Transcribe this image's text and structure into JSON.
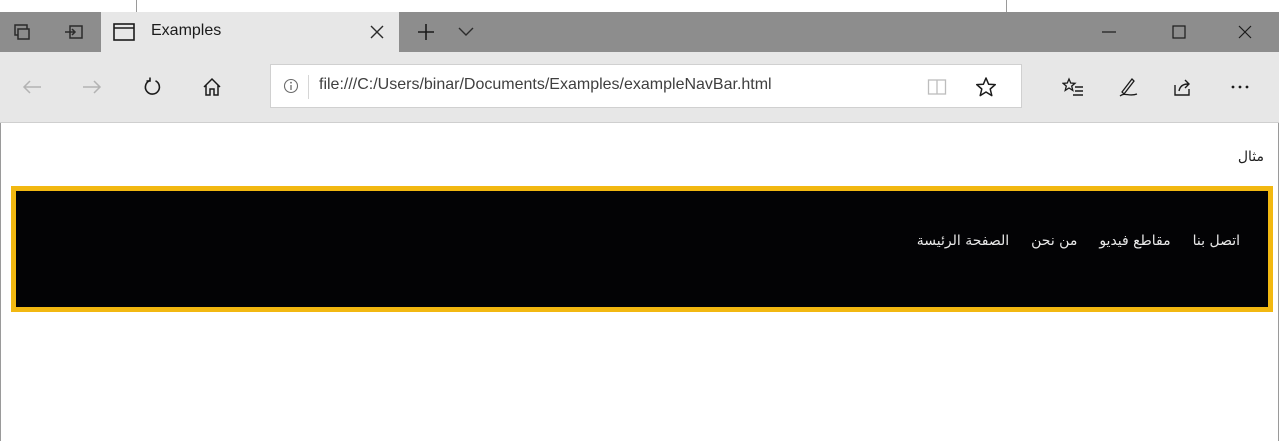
{
  "browser": {
    "tab_title": "Examples",
    "address_url": "file:///C:/Users/binar/Documents/Examples/exampleNavBar.html",
    "icons": {
      "set_aside": "tabs-aside-icon",
      "show_aside": "tabs-restore-icon",
      "tab_page": "page-icon",
      "tab_close": "close-icon",
      "new_tab": "plus-icon",
      "tab_preview": "chevron-down-icon",
      "minimize": "minimize-icon",
      "maximize": "maximize-icon",
      "close_window": "close-icon",
      "back": "arrow-left-icon",
      "forward": "arrow-right-icon",
      "refresh": "refresh-icon",
      "home": "home-icon",
      "info": "info-icon",
      "reading_view": "book-icon",
      "favorite": "star-icon",
      "favorites_hub": "favorites-list-icon",
      "notes": "pen-icon",
      "share": "share-icon",
      "more": "more-icon"
    },
    "colors": {
      "tabstrip": "#8d8d8d",
      "toolbar": "#e7e7e7"
    }
  },
  "page": {
    "heading": "مثال",
    "nav_links": [
      "الصفحة الرئيسة",
      "من نحن",
      "مقاطع فيديو",
      "اتصل بنا"
    ],
    "colors": {
      "nav_background": "#030305",
      "nav_border": "#f2b811",
      "nav_text": "#e8e8e8"
    }
  }
}
